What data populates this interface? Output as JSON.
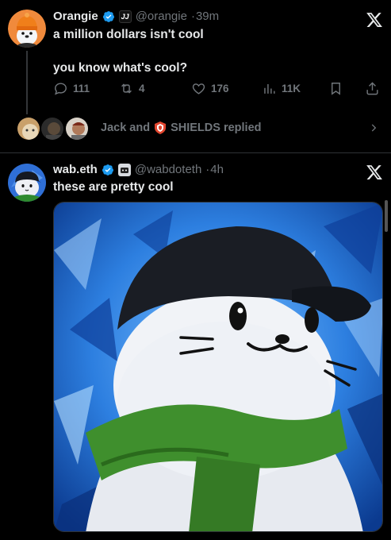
{
  "post1": {
    "author_name": "Orangie",
    "handle": "@orangie",
    "time": "39m",
    "line1": "a million dollars isn't cool",
    "line2": "you know what's cool?",
    "replies": "111",
    "reposts": "4",
    "likes": "176",
    "views": "11K",
    "affiliate_badge": "JJ"
  },
  "replied_bar": {
    "names_prefix": "Jack and",
    "names_suffix": "SHIELDS replied"
  },
  "post2": {
    "author_name": "wab.eth",
    "handle": "@wabdoteth",
    "time": "4h",
    "text": "these are pretty cool"
  },
  "colors": {
    "verified": "#1d9bf0",
    "muted": "#71767b",
    "accent_orange": "#f7931a"
  }
}
